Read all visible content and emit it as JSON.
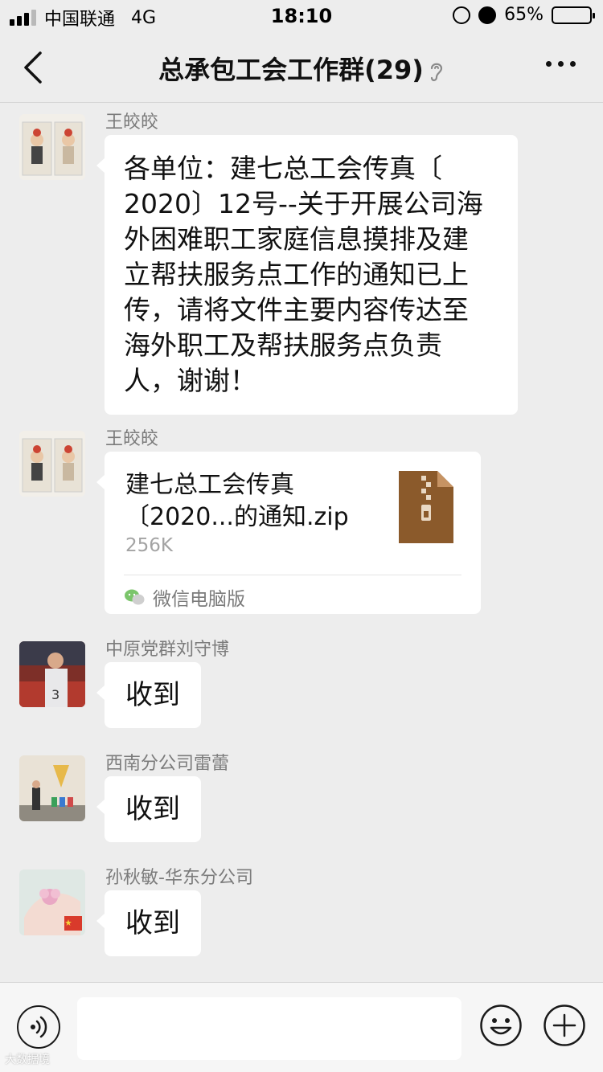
{
  "status_bar": {
    "carrier": "中国联通",
    "network": "4G",
    "time": "18:10",
    "battery": "65%",
    "battery_level": 0.65,
    "signal_bars_on": 3
  },
  "nav": {
    "title": "总承包工会工作群(29)"
  },
  "messages": [
    {
      "sender": "王皎皎",
      "type": "text",
      "lines": [
        "各单位：建七总工会传真〔",
        "2020〕12号--关于开展公司海",
        "外困难职工家庭信息摸排及建",
        "立帮扶服务点工作的通知已上",
        "传，请将文件主要内容传达至",
        "海外职工及帮扶服务点负责",
        "人，谢谢！"
      ]
    },
    {
      "sender": "王皎皎",
      "type": "file",
      "file_name_line1": "建七总工会传真",
      "file_name_line2": "〔2020...的通知.zip",
      "file_size": "256K",
      "source": "微信电脑版"
    },
    {
      "sender": "中原党群刘守博",
      "type": "text",
      "text": "收到"
    },
    {
      "sender": "西南分公司雷蕾",
      "type": "text",
      "text": "收到"
    },
    {
      "sender": "孙秋敏-华东分公司",
      "type": "text",
      "text": "收到"
    }
  ],
  "input_bar": {
    "placeholder": ""
  },
  "watermark": "大数据境"
}
